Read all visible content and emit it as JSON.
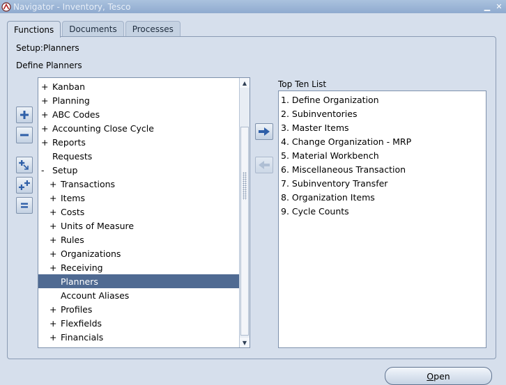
{
  "window": {
    "title": "Navigator - Inventory, Tesco",
    "minimize_glyph": "▁",
    "close_glyph": "✕"
  },
  "tabs": [
    {
      "label": "Functions",
      "active": true
    },
    {
      "label": "Documents",
      "active": false
    },
    {
      "label": "Processes",
      "active": false
    }
  ],
  "breadcrumb": "Setup:Planners",
  "current_function": "Define Planners",
  "tree": {
    "items": [
      {
        "expander": "+",
        "label": "Kanban",
        "level": 0,
        "selected": false
      },
      {
        "expander": "+",
        "label": "Planning",
        "level": 0,
        "selected": false
      },
      {
        "expander": "+",
        "label": "ABC Codes",
        "level": 0,
        "selected": false
      },
      {
        "expander": "+",
        "label": "Accounting Close Cycle",
        "level": 0,
        "selected": false
      },
      {
        "expander": "+",
        "label": "Reports",
        "level": 0,
        "selected": false
      },
      {
        "expander": "",
        "label": "Requests",
        "level": 0,
        "selected": false
      },
      {
        "expander": "-",
        "label": "Setup",
        "level": 0,
        "selected": false
      },
      {
        "expander": "+",
        "label": "Transactions",
        "level": 1,
        "selected": false
      },
      {
        "expander": "+",
        "label": "Items",
        "level": 1,
        "selected": false
      },
      {
        "expander": "+",
        "label": "Costs",
        "level": 1,
        "selected": false
      },
      {
        "expander": "+",
        "label": "Units of Measure",
        "level": 1,
        "selected": false
      },
      {
        "expander": "+",
        "label": "Rules",
        "level": 1,
        "selected": false
      },
      {
        "expander": "+",
        "label": "Organizations",
        "level": 1,
        "selected": false
      },
      {
        "expander": "+",
        "label": "Receiving",
        "level": 1,
        "selected": false
      },
      {
        "expander": "",
        "label": "Planners",
        "level": 1,
        "selected": true
      },
      {
        "expander": "",
        "label": "Account Aliases",
        "level": 1,
        "selected": false
      },
      {
        "expander": "+",
        "label": "Profiles",
        "level": 1,
        "selected": false
      },
      {
        "expander": "+",
        "label": "Flexfields",
        "level": 1,
        "selected": false
      },
      {
        "expander": "+",
        "label": "Financials",
        "level": 1,
        "selected": false
      }
    ]
  },
  "top_ten": {
    "label": "Top Ten List",
    "items": [
      "1. Define Organization",
      "2. Subinventories",
      "3. Master Items",
      "4. Change Organization - MRP",
      "5. Material Workbench",
      "6. Miscellaneous Transaction",
      "7. Subinventory Transfer",
      "8. Organization Items",
      "9. Cycle Counts"
    ]
  },
  "buttons": {
    "open_mnemonic": "O",
    "open_rest": "pen"
  },
  "colors": {
    "selection": "#4F6A92",
    "background": "#D6DFEC",
    "icon_blue": "#2E5FA8"
  },
  "icons": {
    "expand": "plus-icon",
    "collapse": "minus-icon",
    "expand_all": "expand-branch-icon",
    "expand_all_children": "expand-all-icon",
    "collapse_all": "collapse-all-icon",
    "add_to_list": "arrow-right-icon",
    "remove_from_list": "arrow-left-icon"
  }
}
